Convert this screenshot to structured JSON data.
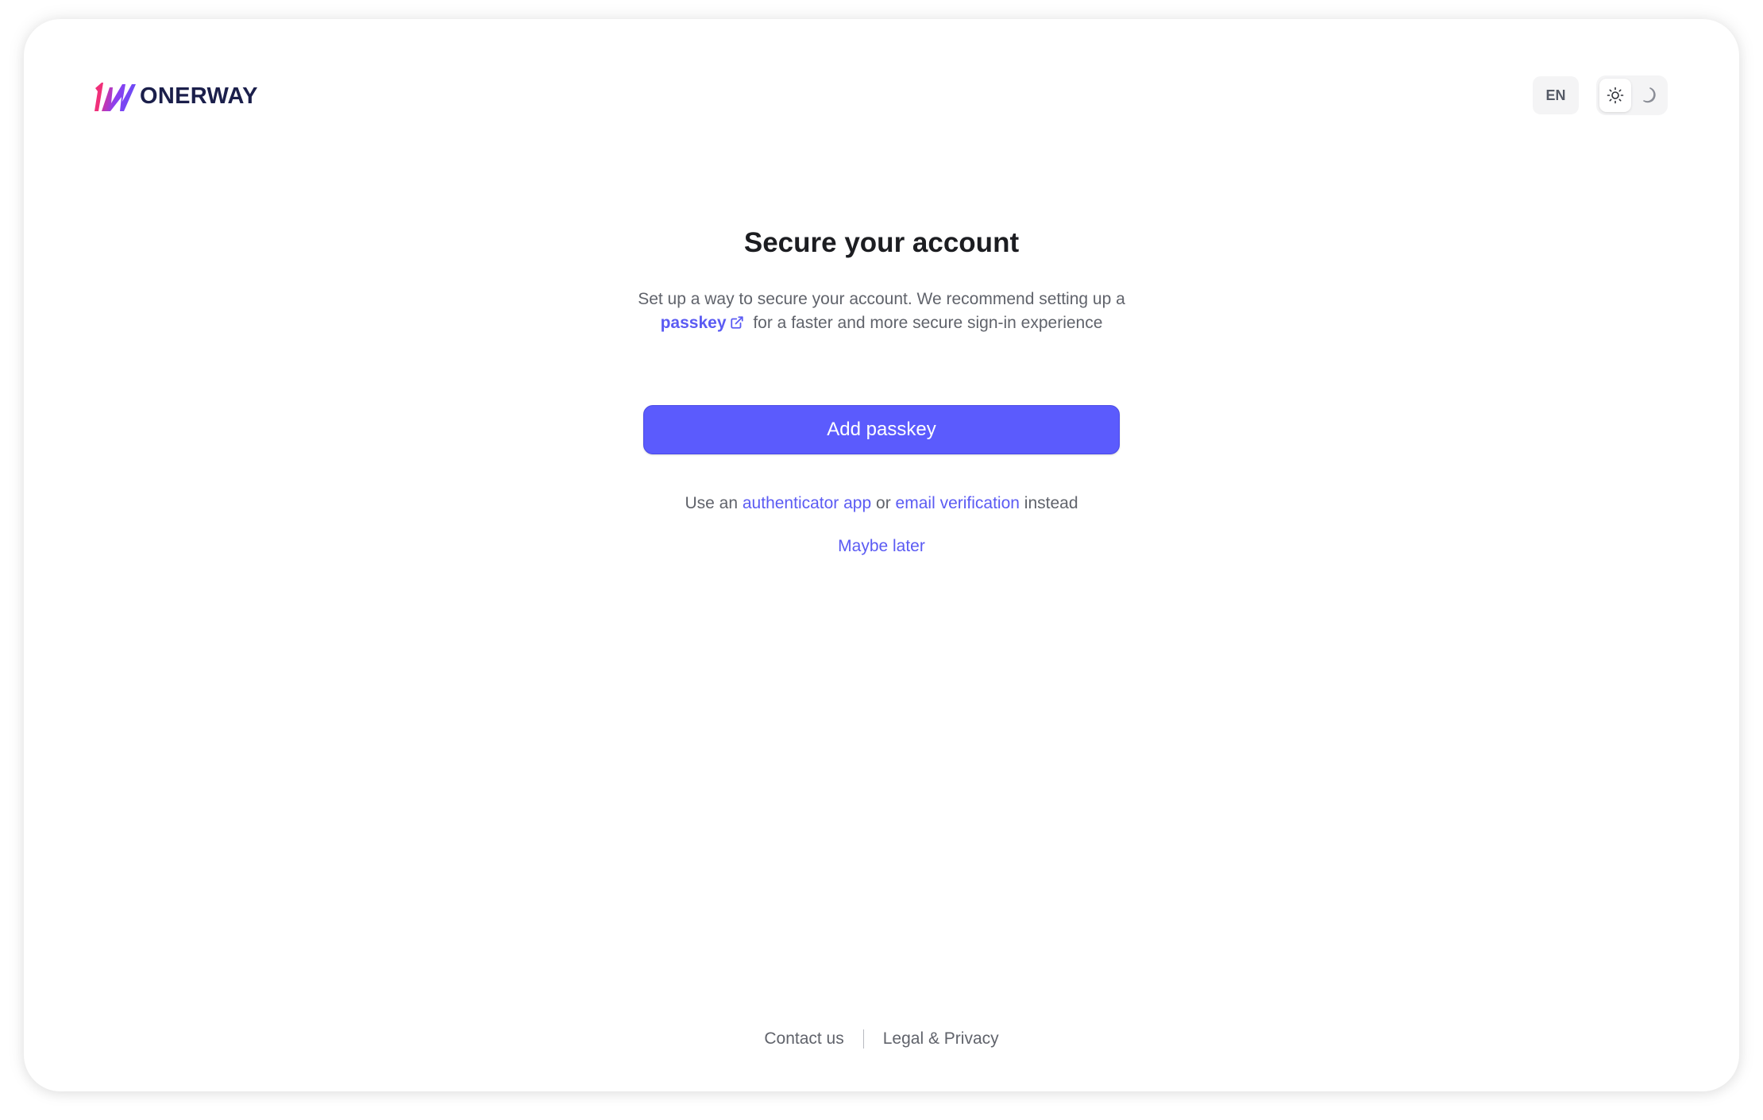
{
  "brand": {
    "name": "ONERWAY",
    "colors": {
      "pink": "#f0307a",
      "purple": "#7b3ff2",
      "blue": "#3b5bdb",
      "text": "#1b1f4b"
    }
  },
  "header": {
    "language": "EN",
    "theme": {
      "light_icon": "sun-icon",
      "dark_icon": "moon-icon",
      "selected": "light"
    }
  },
  "main": {
    "title": "Secure your account",
    "description_before": "Set up a way to secure your account. We recommend setting up a",
    "passkey_link": "passkey",
    "description_after": "for a faster and more secure sign-in experience",
    "primary_button": "Add passkey",
    "alt_prefix": "Use an",
    "authenticator_link": "authenticator app",
    "alt_or": "or",
    "email_link": "email verification",
    "alt_suffix": "instead",
    "maybe_later": "Maybe later"
  },
  "footer": {
    "contact": "Contact us",
    "legal": "Legal & Privacy"
  },
  "colors": {
    "accent": "#5b5bfd",
    "link": "#5b5bf3",
    "muted_text": "#60636b",
    "title_text": "#1c1d21"
  }
}
